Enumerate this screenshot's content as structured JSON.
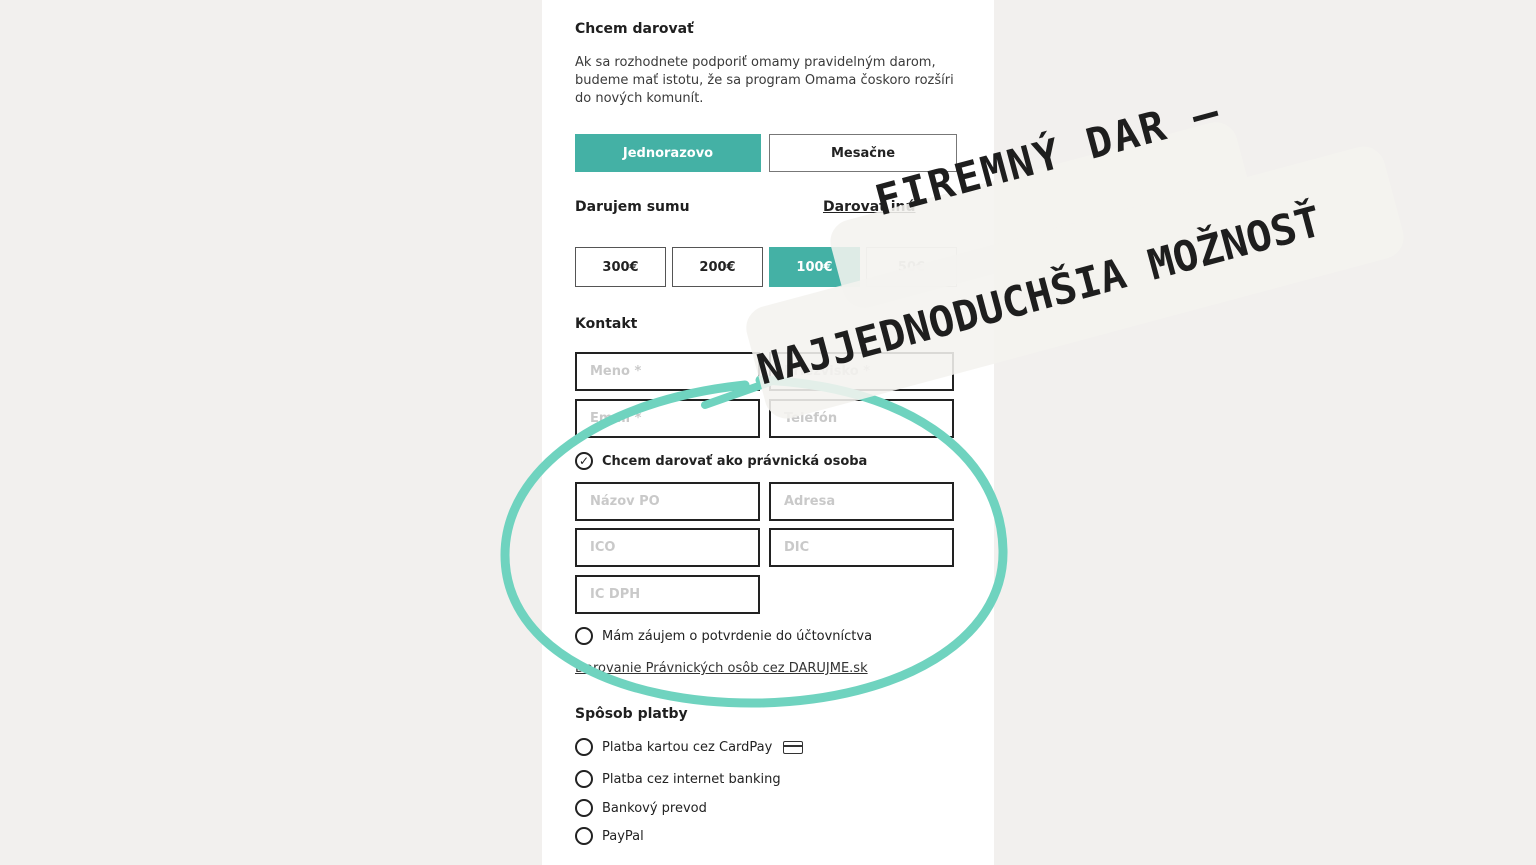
{
  "donate": {
    "title": "Chcem darovať",
    "intro": "Ak sa rozhodnete podporiť omamy pravidelným darom, budeme mať istotu, že sa program Omama čoskoro rozšíri do nových komunít."
  },
  "frequency": {
    "once": "Jednorazovo",
    "monthly": "Mesačne",
    "selected": "Jednorazovo"
  },
  "amount": {
    "title": "Darujem sumu",
    "other_link": "Darovať inú",
    "options": [
      "300€",
      "200€",
      "100€",
      "50€"
    ],
    "selected": "100€"
  },
  "contact": {
    "title": "Kontakt",
    "first_name_placeholder": "Meno *",
    "last_name_placeholder": "Priezvisko *",
    "email_placeholder": "Email *",
    "phone_placeholder": "Telefón",
    "legal_checkbox": "Chcem darovať ako právnická osoba",
    "legal_checked": true,
    "company_name_placeholder": "Názov PO",
    "address_placeholder": "Adresa",
    "ico_placeholder": "IČO",
    "dic_placeholder": "DIČ",
    "icdph_placeholder": "IČ DPH",
    "accounting_checkbox": "Mám záujem o potvrdenie do účtovníctva",
    "legal_link": "Darovanie Právnických osôb cez DARUJME.sk"
  },
  "payment": {
    "title": "Spôsob platby",
    "options": [
      {
        "label": "Platba kartou cez CardPay",
        "icon": "credit-card-icon"
      },
      {
        "label": "Platba cez internet banking"
      },
      {
        "label": "Bankový prevod"
      },
      {
        "label": "PayPal"
      }
    ]
  },
  "annotation": {
    "line1": "Firemný dar –",
    "line2": "najjednoduchšia možnosť",
    "circle_color": "#6fd3bf"
  },
  "colors": {
    "accent": "#44b1a5",
    "page_bg": "#f2f0ee"
  }
}
